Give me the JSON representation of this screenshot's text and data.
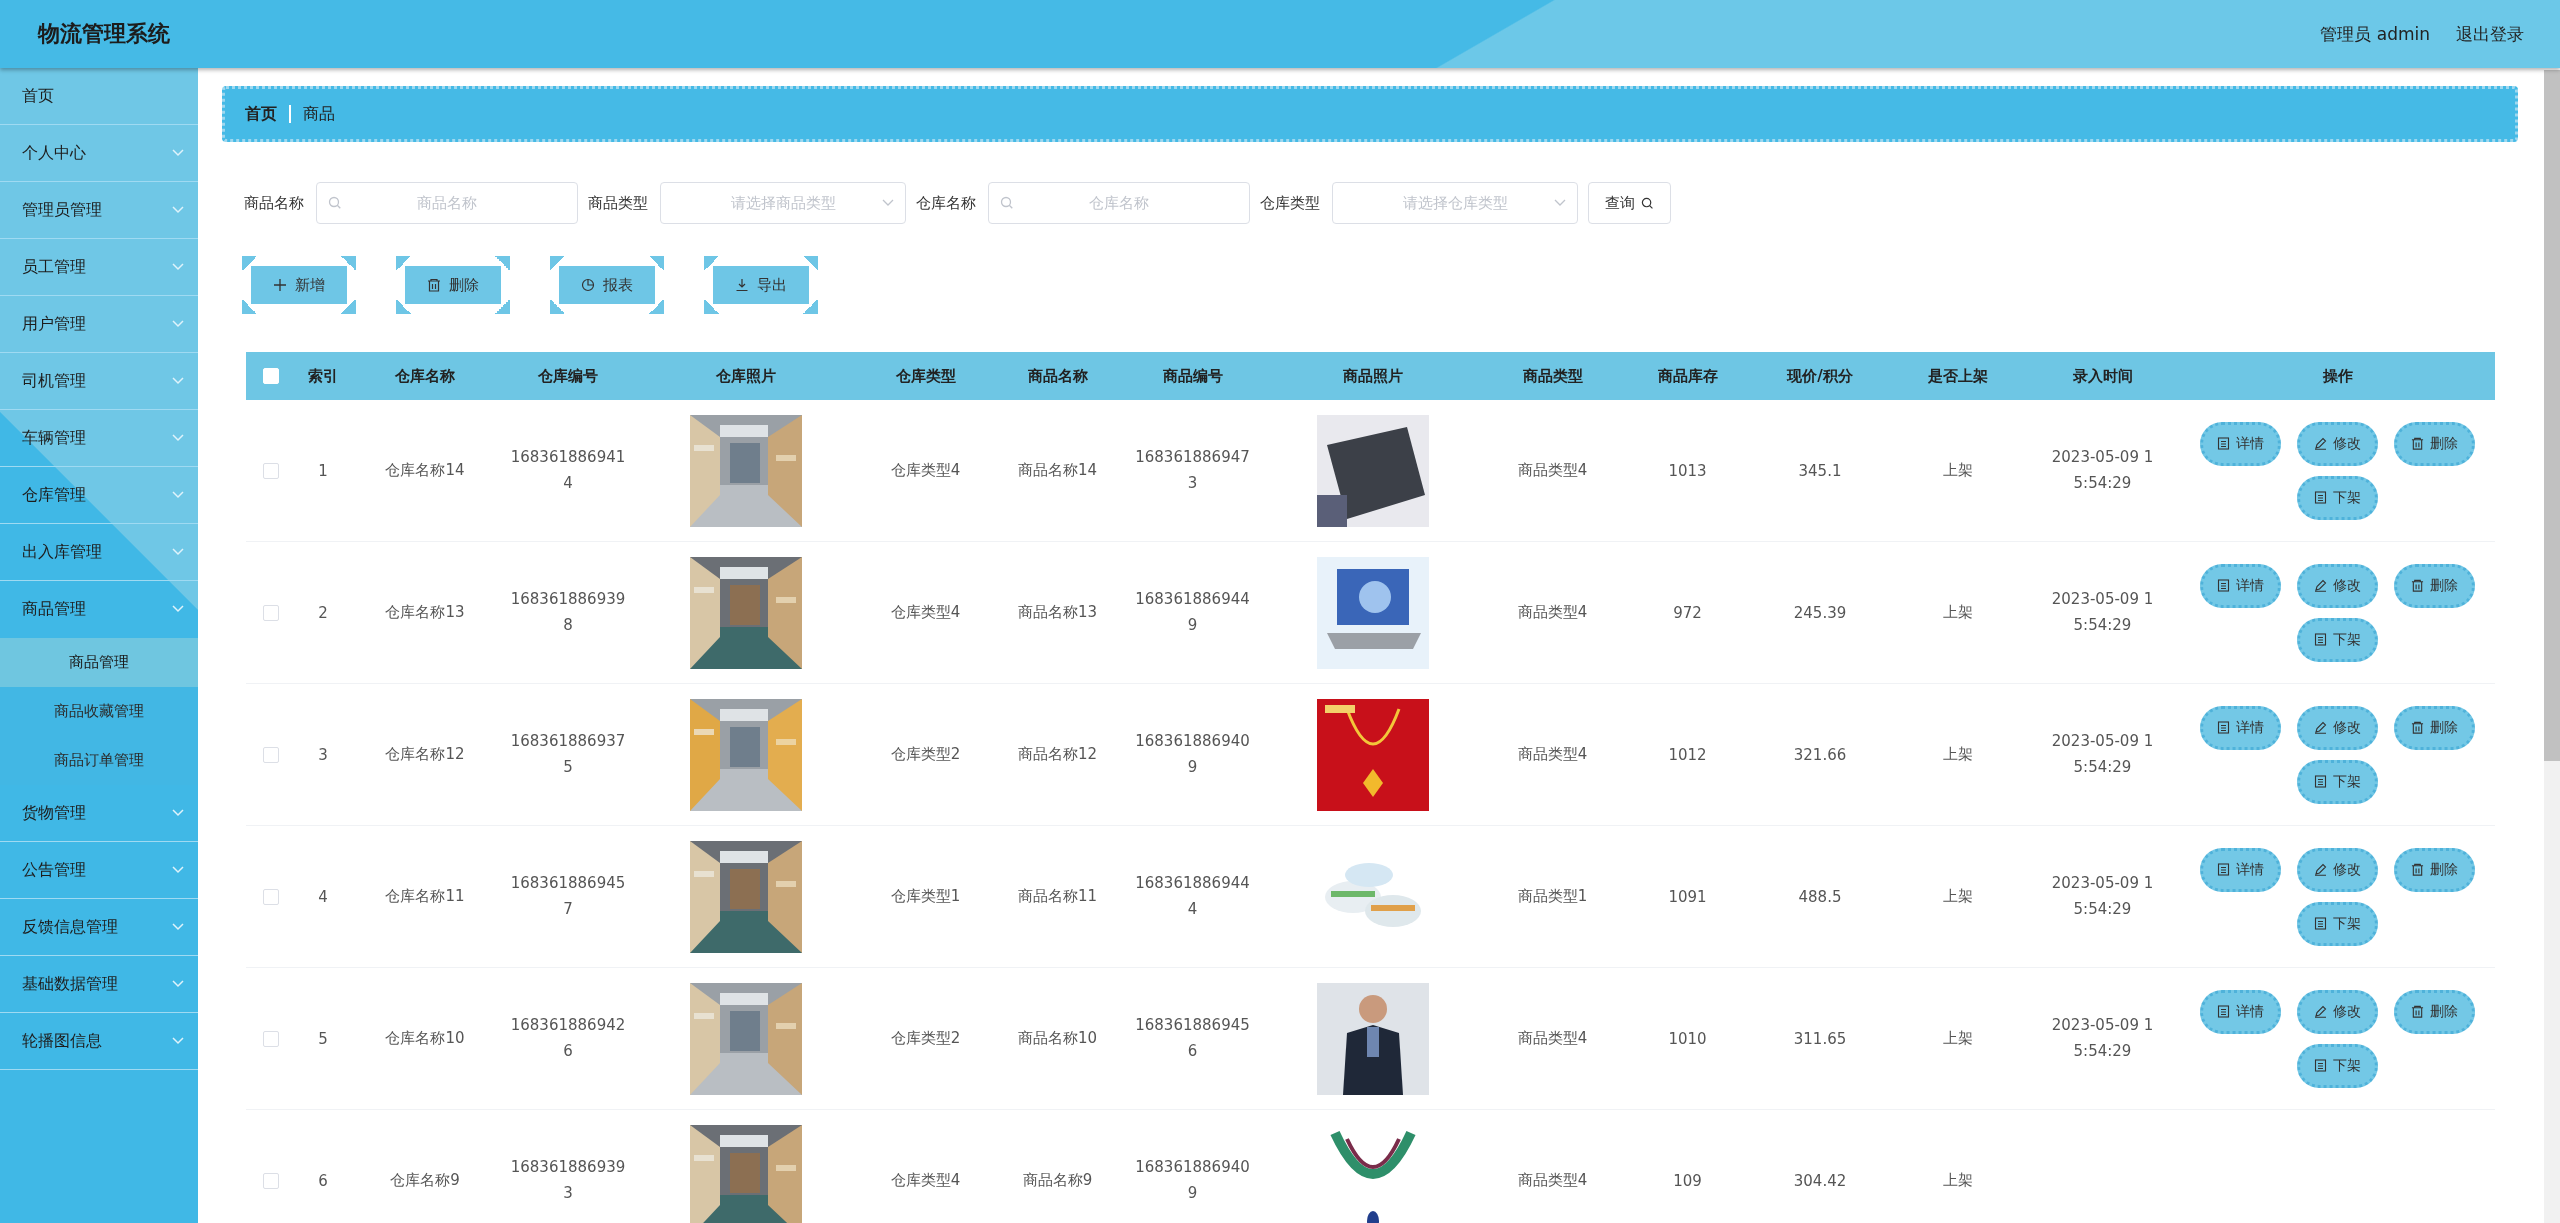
{
  "header": {
    "title": "物流管理系统",
    "user": "管理员 admin",
    "logout": "退出登录"
  },
  "sidebar": {
    "items": [
      {
        "label": "首页",
        "kind": "link"
      },
      {
        "label": "个人中心",
        "kind": "submenu"
      },
      {
        "label": "管理员管理",
        "kind": "submenu"
      },
      {
        "label": "员工管理",
        "kind": "submenu"
      },
      {
        "label": "用户管理",
        "kind": "submenu"
      },
      {
        "label": "司机管理",
        "kind": "submenu"
      },
      {
        "label": "车辆管理",
        "kind": "submenu"
      },
      {
        "label": "仓库管理",
        "kind": "submenu"
      },
      {
        "label": "出入库管理",
        "kind": "submenu"
      },
      {
        "label": "商品管理",
        "kind": "submenu",
        "expanded": true,
        "children": [
          {
            "label": "商品管理",
            "selected": true
          },
          {
            "label": "商品收藏管理",
            "selected": false
          },
          {
            "label": "商品订单管理",
            "selected": false
          }
        ]
      },
      {
        "label": "货物管理",
        "kind": "submenu"
      },
      {
        "label": "公告管理",
        "kind": "submenu"
      },
      {
        "label": "反馈信息管理",
        "kind": "submenu"
      },
      {
        "label": "基础数据管理",
        "kind": "submenu"
      },
      {
        "label": "轮播图信息",
        "kind": "submenu"
      }
    ]
  },
  "breadcrumb": [
    "首页",
    "商品"
  ],
  "filters": [
    {
      "label": "商品名称",
      "kind": "input",
      "placeholder": "商品名称"
    },
    {
      "label": "商品类型",
      "kind": "select",
      "placeholder": "请选择商品类型"
    },
    {
      "label": "仓库名称",
      "kind": "input",
      "placeholder": "仓库名称"
    },
    {
      "label": "仓库类型",
      "kind": "select",
      "placeholder": "请选择仓库类型"
    }
  ],
  "search_button": "查询",
  "toolbar": [
    {
      "label": "新增",
      "kind": "add"
    },
    {
      "label": "删除",
      "kind": "delete"
    },
    {
      "label": "报表",
      "kind": "report"
    },
    {
      "label": "导出",
      "kind": "export"
    }
  ],
  "table": {
    "select_all": {
      "checked": false
    },
    "columns": [
      "索引",
      "仓库名称",
      "仓库编号",
      "仓库照片",
      "仓库类型",
      "商品名称",
      "商品编号",
      "商品照片",
      "商品类型",
      "商品库存",
      "现价/积分",
      "是否上架",
      "录入时间",
      "操作"
    ],
    "rows": [
      {
        "checked": false,
        "index": "1",
        "warehouse_name": "仓库名称14",
        "warehouse_no": "1683618869414",
        "warehouse_photo": {
          "kind": "picture"
        },
        "warehouse_type": "仓库类型4",
        "goods_name": "商品名称14",
        "goods_no": "1683618869473",
        "goods_photo": {
          "kind": "picture"
        },
        "goods_type": "商品类型4",
        "stock": "1013",
        "price": "345.1",
        "on_shelf": "上架",
        "created": "2023-05-09 15:54:29",
        "actions": [
          {
            "label": "详情",
            "kind": "detail"
          },
          {
            "label": "修改",
            "kind": "edit"
          },
          {
            "label": "删除",
            "kind": "delete"
          },
          {
            "label": "下架",
            "kind": "detail"
          }
        ]
      },
      {
        "checked": false,
        "index": "2",
        "warehouse_name": "仓库名称13",
        "warehouse_no": "1683618869398",
        "warehouse_photo": {
          "kind": "picture"
        },
        "warehouse_type": "仓库类型4",
        "goods_name": "商品名称13",
        "goods_no": "1683618869449",
        "goods_photo": {
          "kind": "picture"
        },
        "goods_type": "商品类型4",
        "stock": "972",
        "price": "245.39",
        "on_shelf": "上架",
        "created": "2023-05-09 15:54:29",
        "actions": [
          {
            "label": "详情",
            "kind": "detail"
          },
          {
            "label": "修改",
            "kind": "edit"
          },
          {
            "label": "删除",
            "kind": "delete"
          },
          {
            "label": "下架",
            "kind": "detail"
          }
        ]
      },
      {
        "checked": false,
        "index": "3",
        "warehouse_name": "仓库名称12",
        "warehouse_no": "1683618869375",
        "warehouse_photo": {
          "kind": "picture"
        },
        "warehouse_type": "仓库类型2",
        "goods_name": "商品名称12",
        "goods_no": "1683618869409",
        "goods_photo": {
          "kind": "picture"
        },
        "goods_type": "商品类型4",
        "stock": "1012",
        "price": "321.66",
        "on_shelf": "上架",
        "created": "2023-05-09 15:54:29",
        "actions": [
          {
            "label": "详情",
            "kind": "detail"
          },
          {
            "label": "修改",
            "kind": "edit"
          },
          {
            "label": "删除",
            "kind": "delete"
          },
          {
            "label": "下架",
            "kind": "detail"
          }
        ]
      },
      {
        "checked": false,
        "index": "4",
        "warehouse_name": "仓库名称11",
        "warehouse_no": "1683618869457",
        "warehouse_photo": {
          "kind": "picture"
        },
        "warehouse_type": "仓库类型1",
        "goods_name": "商品名称11",
        "goods_no": "1683618869444",
        "goods_photo": {
          "kind": "picture"
        },
        "goods_type": "商品类型1",
        "stock": "1091",
        "price": "488.5",
        "on_shelf": "上架",
        "created": "2023-05-09 15:54:29",
        "actions": [
          {
            "label": "详情",
            "kind": "detail"
          },
          {
            "label": "修改",
            "kind": "edit"
          },
          {
            "label": "删除",
            "kind": "delete"
          },
          {
            "label": "下架",
            "kind": "detail"
          }
        ]
      },
      {
        "checked": false,
        "index": "5",
        "warehouse_name": "仓库名称10",
        "warehouse_no": "1683618869426",
        "warehouse_photo": {
          "kind": "picture"
        },
        "warehouse_type": "仓库类型2",
        "goods_name": "商品名称10",
        "goods_no": "1683618869456",
        "goods_photo": {
          "kind": "picture"
        },
        "goods_type": "商品类型4",
        "stock": "1010",
        "price": "311.65",
        "on_shelf": "上架",
        "created": "2023-05-09 15:54:29",
        "actions": [
          {
            "label": "详情",
            "kind": "detail"
          },
          {
            "label": "修改",
            "kind": "edit"
          },
          {
            "label": "删除",
            "kind": "delete"
          },
          {
            "label": "下架",
            "kind": "detail"
          }
        ]
      },
      {
        "checked": false,
        "index": "6",
        "warehouse_name": "仓库名称9",
        "warehouse_no": "1683618869393",
        "warehouse_photo": {
          "kind": "picture"
        },
        "warehouse_type": "仓库类型4",
        "goods_name": "商品名称9",
        "goods_no": "1683618869409",
        "goods_photo": {
          "kind": "picture"
        },
        "goods_type": "商品类型4",
        "stock": "109",
        "price": "304.42",
        "on_shelf": "上架"
      }
    ]
  }
}
